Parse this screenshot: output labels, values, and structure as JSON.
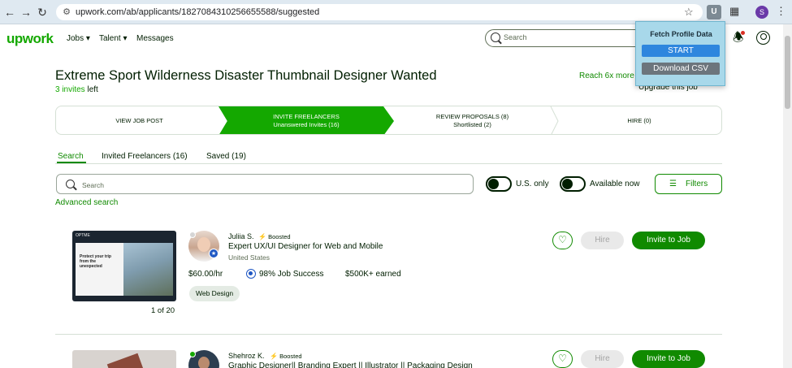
{
  "browser": {
    "url": "upwork.com/ab/applicants/1827084310256655588/suggested",
    "back_icon": "arrow-left-icon",
    "forward_icon": "arrow-right-icon",
    "reload_icon": "reload-icon",
    "extension_badge": "U",
    "profile_initial": "S"
  },
  "header": {
    "logo": "upwork",
    "nav": [
      "Jobs",
      "Talent",
      "Messages"
    ],
    "search_placeholder": "Search"
  },
  "extension_popup": {
    "title": "Fetch Profile Data",
    "start_label": "START",
    "csv_label": "Download CSV"
  },
  "job": {
    "title": "Extreme Sport Wilderness Disaster Thumbnail Designer Wanted",
    "invites_count": "3 invites",
    "invites_suffix": " left",
    "reach": "Reach 6x more",
    "upgrade": "Upgrade this job"
  },
  "stepper": [
    {
      "label": "VIEW JOB POST",
      "sub": ""
    },
    {
      "label": "INVITE FREELANCERS",
      "sub": "Unanswered Invites (16)"
    },
    {
      "label": "REVIEW PROPOSALS (8)",
      "sub": "Shortlisted (2)"
    },
    {
      "label": "HIRE (0)",
      "sub": ""
    }
  ],
  "tabs": [
    {
      "label": "Search"
    },
    {
      "label": "Invited Freelancers (16)"
    },
    {
      "label": "Saved (19)"
    }
  ],
  "search": {
    "placeholder": "Search",
    "us_only": "U.S. only",
    "available_now": "Available now",
    "filters": "Filters",
    "advanced": "Advanced search"
  },
  "freelancers": [
    {
      "name": "Juliia S.",
      "boosted": "Boosted",
      "title": "Expert UX/UI Designer for Web and Mobile",
      "location": "United States",
      "rate": "$60.00/hr",
      "job_success": "98% Job Success",
      "earned": "$500K+ earned",
      "skill": "Web Design",
      "portfolio_count": "1 of 20",
      "thumb_header": "OPTME",
      "thumb_text": "Protect your trip from the unexpected",
      "hire": "Hire",
      "invite": "Invite to Job"
    },
    {
      "name": "Shehroz K.",
      "boosted": "Boosted",
      "title": "Graphic Designer|| Branding Expert || Illustrator || Packaging Design",
      "hire": "Hire",
      "invite": "Invite to Job"
    }
  ]
}
